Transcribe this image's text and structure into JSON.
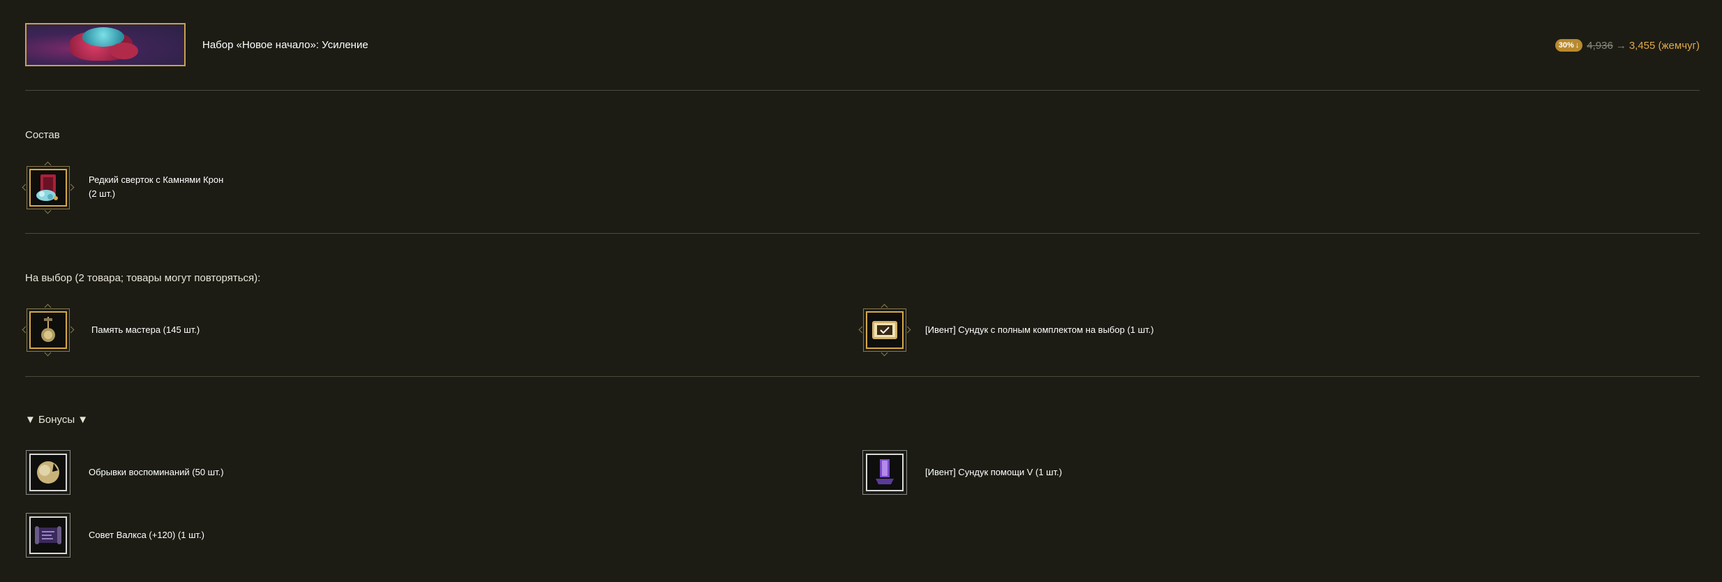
{
  "header": {
    "title": "Набор «Новое начало»: Усиление",
    "discount_badge": "30%",
    "old_price": "4,936",
    "arrow": "→",
    "new_price": "3,455 (жемчуг)"
  },
  "composition": {
    "title": "Состав",
    "items": [
      {
        "label": "Редкий сверток с Камнями Крон",
        "qty": "(2 шт.)",
        "icon": "crown-stones-bundle-icon"
      }
    ]
  },
  "choice": {
    "title": "На выбор (2 товара; товары могут повторяться):",
    "items": [
      {
        "label": "Память мастера (145 шт.)",
        "icon": "master-memory-icon"
      },
      {
        "label": "[Ивент] Сундук с полным комплектом на выбор (1 шт.)",
        "icon": "full-set-chest-icon"
      }
    ]
  },
  "bonuses": {
    "title": "▼ Бонусы ▼",
    "items": [
      {
        "label": "Обрывки воспоминаний (50 шт.)",
        "icon": "memory-fragment-icon"
      },
      {
        "label": "[Ивент] Сундук помощи V (1 шт.)",
        "icon": "help-chest-icon"
      },
      {
        "label": "Совет Валкса (+120) (1 шт.)",
        "icon": "valks-advice-scroll-icon"
      }
    ]
  },
  "colors": {
    "background": "#1c1c14",
    "gold_border": "#d6a84a",
    "price_accent": "#e0a84a",
    "badge": "#b88a2e"
  }
}
